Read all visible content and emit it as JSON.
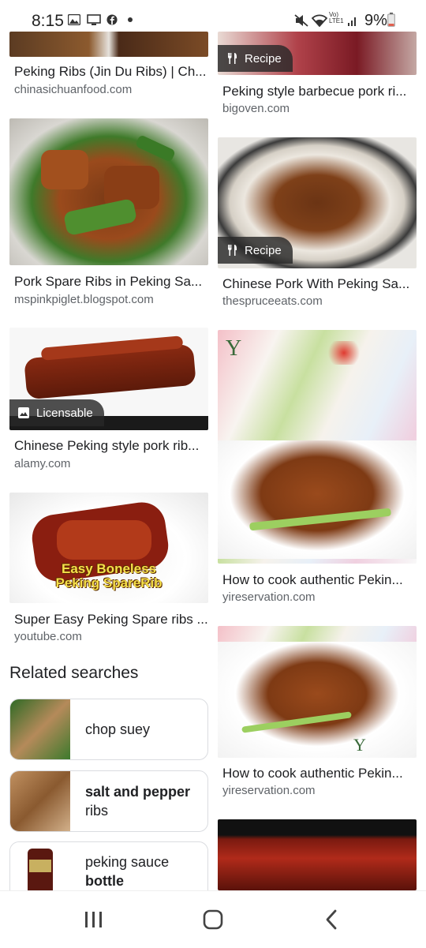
{
  "status_bar": {
    "time": "8:15",
    "battery": "9%",
    "network_label": "Vo) LTE1",
    "icons": [
      "image-icon",
      "screen-icon",
      "facebook-icon",
      "dot-icon",
      "mute-icon",
      "wifi-icon",
      "signal-icon",
      "battery-icon"
    ]
  },
  "left_column": [
    {
      "title": "Peking Ribs (Jin Du Ribs) | Ch...",
      "source": "chinasichuanfood.com"
    },
    {
      "title": "Pork Spare Ribs in Peking Sa...",
      "source": "mspinkpiglet.blogspot.com"
    },
    {
      "title": "Chinese Peking style pork rib...",
      "source": "alamy.com",
      "badge": "Licensable"
    },
    {
      "title": "Super Easy Peking Spare ribs ...",
      "source": "youtube.com",
      "overlay_text": [
        "Easy Boneless",
        "Peking SpareRib"
      ]
    }
  ],
  "right_column": [
    {
      "title": "Peking style barbecue pork ri...",
      "source": "bigoven.com",
      "badge": "Recipe"
    },
    {
      "title": "Chinese Pork With Peking Sa...",
      "source": "thespruceeats.com",
      "badge": "Recipe"
    },
    {
      "title": "How to cook authentic Pekin...",
      "source": "yireservation.com"
    },
    {
      "title": "How to cook authentic Pekin...",
      "source": "yireservation.com"
    }
  ],
  "related": {
    "heading": "Related searches",
    "items": [
      {
        "plain": "chop suey",
        "bold": ""
      },
      {
        "plain": "ribs",
        "bold": "salt and pepper"
      },
      {
        "plain": "peking sauce",
        "bold": "bottle"
      }
    ]
  },
  "colors": {
    "accent_text": "#202124",
    "secondary_text": "#5f6368",
    "chip_bg": "#282828"
  }
}
